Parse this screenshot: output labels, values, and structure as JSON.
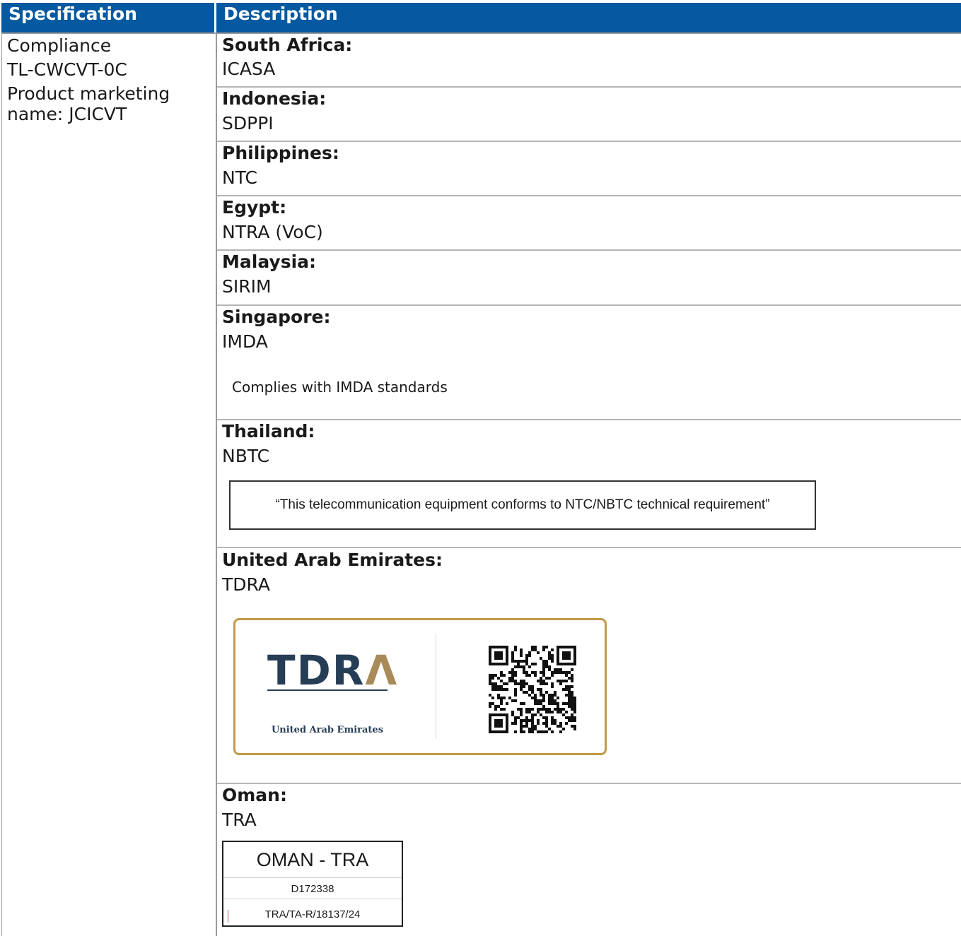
{
  "table": {
    "header": {
      "specification": "Specification",
      "description": "Description"
    },
    "spec": {
      "line1": "Compliance",
      "line2": "TL-CWCVT-0C",
      "line3": "Product marketing",
      "line4": "name: JCICVT"
    },
    "rows": [
      {
        "country": "South Africa:",
        "agency": "ICASA"
      },
      {
        "country": "Indonesia:",
        "agency": "SDPPI"
      },
      {
        "country": "Philippines:",
        "agency": "NTC"
      },
      {
        "country": "Egypt:",
        "agency": "NTRA (VoC)"
      },
      {
        "country": "Malaysia:",
        "agency": "SIRIM"
      },
      {
        "country": "Singapore:",
        "agency": "IMDA",
        "note": "Complies with IMDA standards"
      },
      {
        "country": "Thailand:",
        "agency": "NBTC",
        "statement": "“This telecommunication equipment conforms to NTC/NBTC technical requirement”"
      },
      {
        "country": "United Arab Emirates:",
        "agency": "TDRA",
        "label": {
          "logo_main": "TDR",
          "logo_accent": "Λ",
          "country": "United Arab Emirates"
        }
      },
      {
        "country": "Oman:",
        "agency": "TRA",
        "label": {
          "title": "OMAN - TRA",
          "dealer": "D172338",
          "type_approval": "TRA/TA-R/18137/24"
        }
      }
    ]
  },
  "colors": {
    "header_bg": "#0559a1",
    "tdra_border": "#c09a4a",
    "tdra_navy": "#263d56",
    "tdra_gold": "#a88b58"
  }
}
